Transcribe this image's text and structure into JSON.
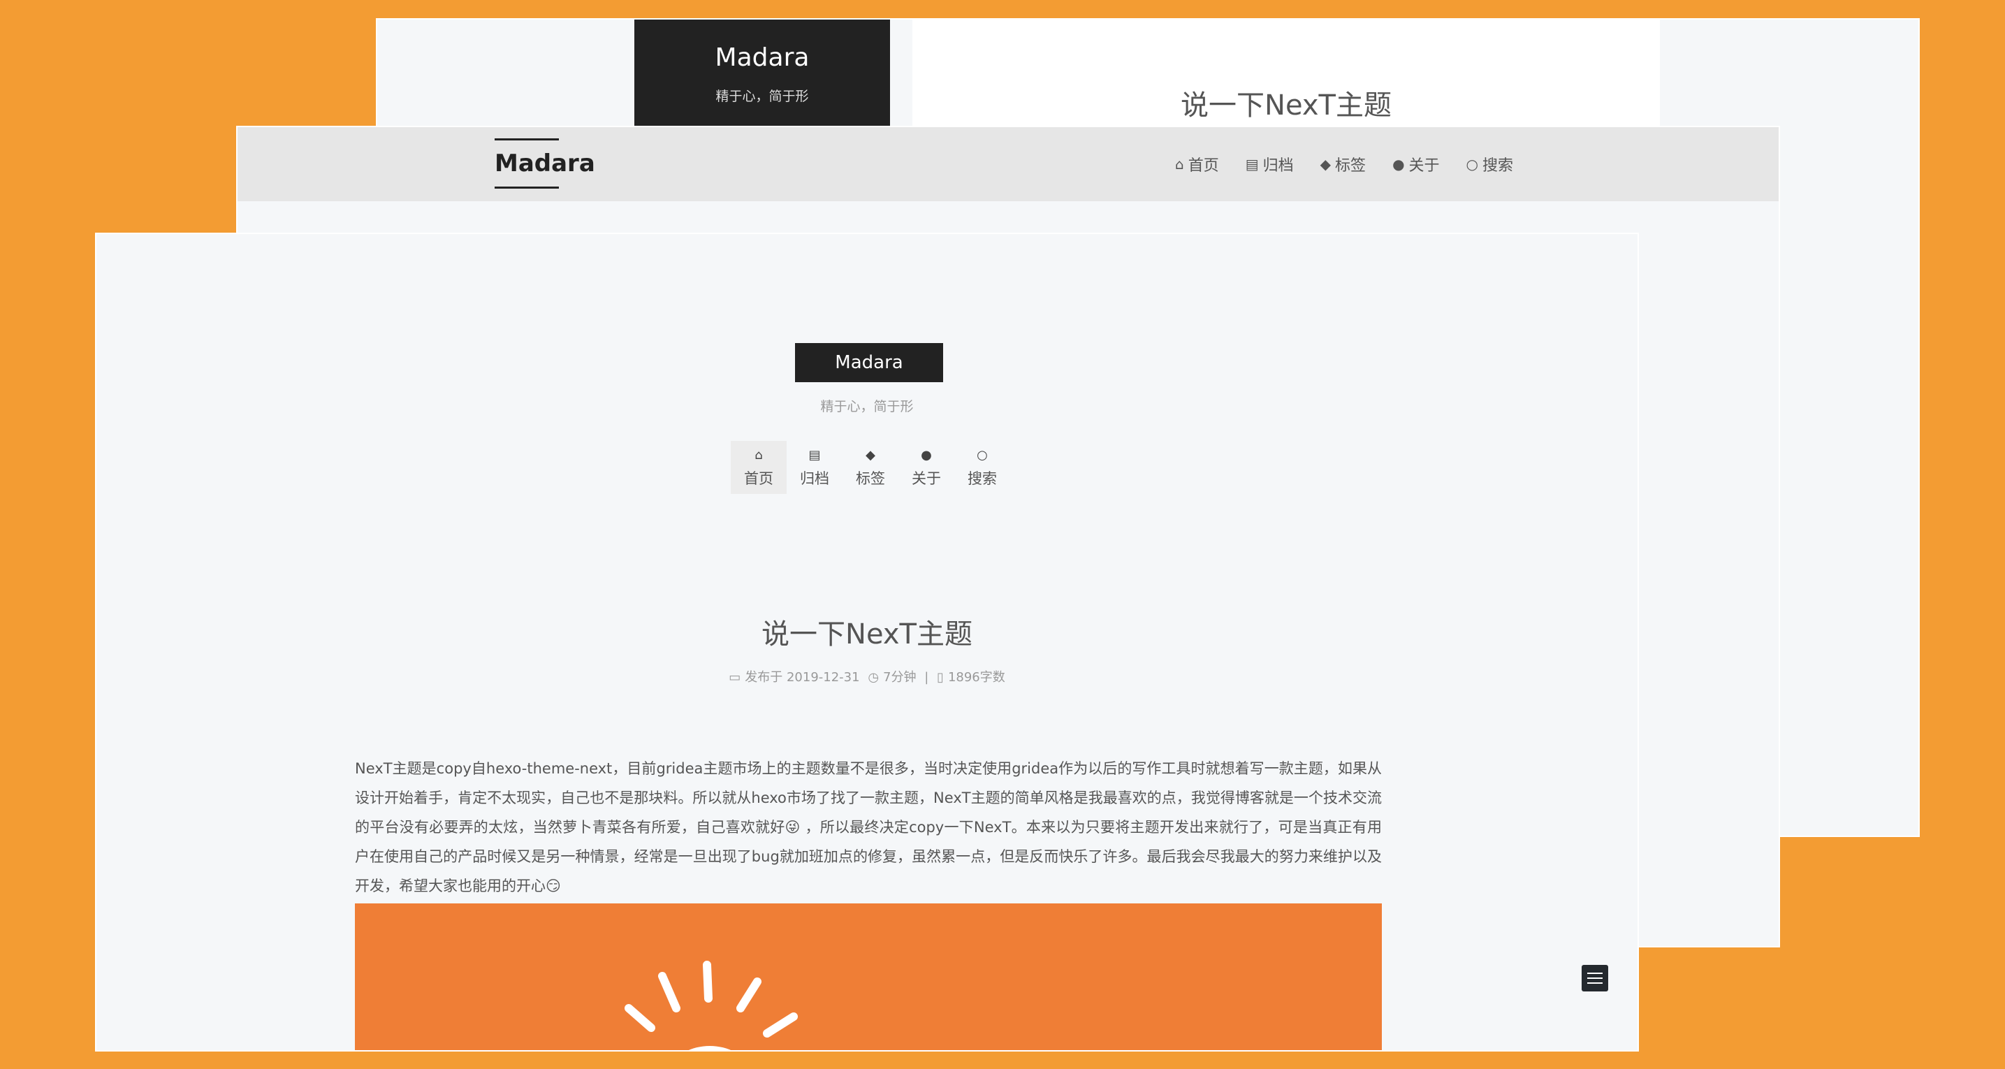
{
  "colors": {
    "background": "#f39c33",
    "brand_dark": "#222222",
    "page_bg": "#f5f7f9",
    "header_bg": "#e6e6e6",
    "hero_orange": "#ef7e36"
  },
  "back": {
    "brand_title": "Madara",
    "brand_subtitle": "精于心，简于形",
    "post_title": "说一下NexT主题"
  },
  "mid": {
    "logo": "Madara",
    "menu": [
      {
        "icon": "home-icon",
        "label": "首页"
      },
      {
        "icon": "archive-icon",
        "label": "归档"
      },
      {
        "icon": "tags-icon",
        "label": "标签"
      },
      {
        "icon": "user-icon",
        "label": "关于"
      },
      {
        "icon": "search-icon",
        "label": "搜索"
      }
    ]
  },
  "front": {
    "brand_title": "Madara",
    "brand_subtitle": "精于心，简于形",
    "nav": [
      {
        "icon": "home-icon",
        "label": "首页"
      },
      {
        "icon": "archive-icon",
        "label": "归档"
      },
      {
        "icon": "tags-icon",
        "label": "标签"
      },
      {
        "icon": "user-icon",
        "label": "关于"
      },
      {
        "icon": "search-icon",
        "label": "搜索"
      }
    ],
    "post_title": "说一下NexT主题",
    "meta": {
      "published": "发布于 2019-12-31",
      "reading_time": "7分钟",
      "separator": "|",
      "word_count": "1896字数"
    },
    "body": "NexT主题是copy自hexo-theme-next，目前gridea主题市场上的主题数量不是很多，当时决定使用gridea作为以后的写作工具时就想着写一款主题，如果从设计开始着手，肯定不太现实，自己也不是那块料。所以就从hexo市场了找了一款主题，NexT主题的简单风格是我最喜欢的点，我觉得博客就是一个技术交流的平台没有必要弄的太炫，当然萝卜青菜各有所爱，自己喜欢就好😜 ，所以最终决定copy一下NexT。本来以为只要将主题开发出来就行了，可是当真正有用户在使用自己的产品时候又是另一种情景，经常是一旦出现了bug就加班加点的修复，虽然累一点，但是反而快乐了许多。最后我会尽我最大的努力来维护以及开发，希望大家也能用的开心😏"
  }
}
